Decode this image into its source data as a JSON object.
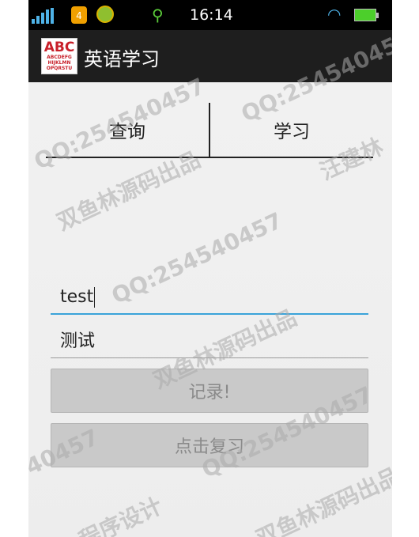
{
  "status_bar": {
    "time": "16:14",
    "notification_count": "4",
    "icons": [
      "signal-icon",
      "notification-badge-icon",
      "app-notification-icon",
      "usb-icon",
      "wifi-icon",
      "battery-icon"
    ]
  },
  "action_bar": {
    "logo_big": "ABC",
    "logo_small": "ABCDEFG HIJKLMN OPQRSTU",
    "title": "英语学习"
  },
  "tabs": [
    {
      "label": "查询"
    },
    {
      "label": "学习"
    }
  ],
  "form": {
    "word_value": "test",
    "meaning_value": "测试"
  },
  "buttons": {
    "record_label": "记录!",
    "review_label": "点击复习"
  },
  "watermarks": {
    "qq": "QQ:254540457",
    "studio": "双鱼林源码出品",
    "author": "汪建林",
    "design": "程序设计",
    "qq_partial": "40457",
    "studio_partial": "双鱼林源码出品"
  },
  "colors": {
    "status_bar_bg": "#000000",
    "action_bar_bg": "#1e1e1e",
    "focus_underline": "#3aa3d9",
    "button_bg": "#c9c9c9",
    "button_text": "#8a8a8a"
  }
}
